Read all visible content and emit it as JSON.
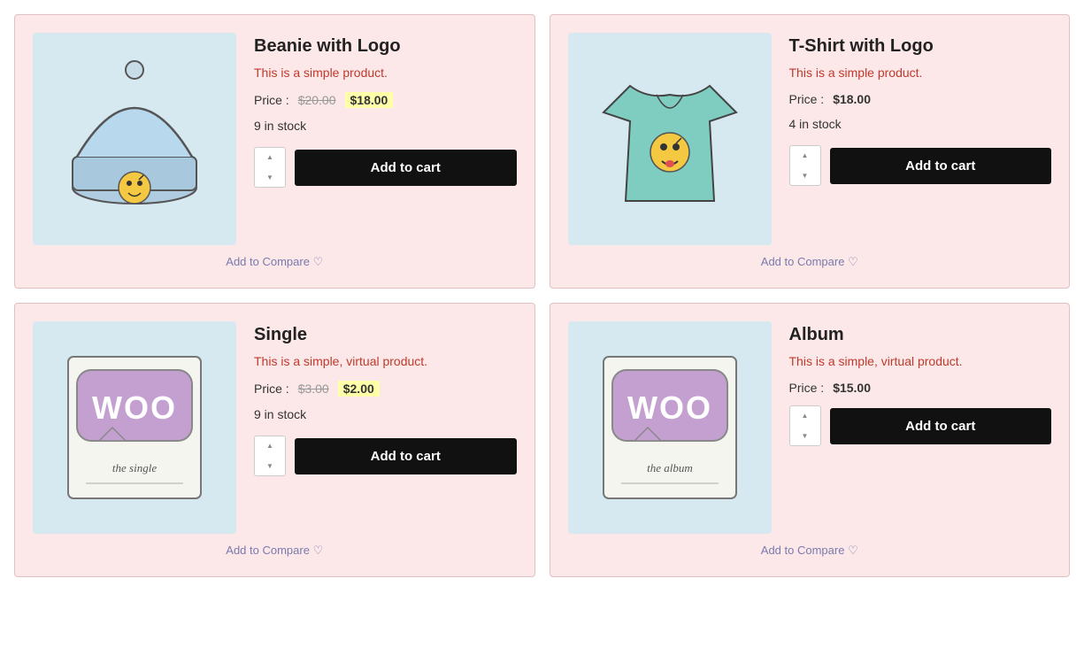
{
  "products": [
    {
      "id": "beanie-with-logo",
      "title": "Beanie with Logo",
      "description": "This is a simple product.",
      "price_label": "Price :",
      "price_old": "$20.00",
      "price_new": "$18.00",
      "price_new_highlighted": true,
      "price_current": null,
      "stock": "9 in stock",
      "add_to_cart_label": "Add to cart",
      "compare_label": "Add to Compare",
      "image_type": "beanie"
    },
    {
      "id": "tshirt-with-logo",
      "title": "T-Shirt with Logo",
      "description": "This is a simple product.",
      "price_label": "Price :",
      "price_old": null,
      "price_new": null,
      "price_new_highlighted": false,
      "price_current": "$18.00",
      "stock": "4 in stock",
      "add_to_cart_label": "Add to cart",
      "compare_label": "Add to Compare",
      "image_type": "tshirt"
    },
    {
      "id": "single",
      "title": "Single",
      "description": "This is a simple, virtual product.",
      "price_label": "Price :",
      "price_old": "$3.00",
      "price_new": "$2.00",
      "price_new_highlighted": true,
      "price_current": null,
      "stock": "9 in stock",
      "add_to_cart_label": "Add to cart",
      "compare_label": "Add to Compare",
      "image_type": "single"
    },
    {
      "id": "album",
      "title": "Album",
      "description": "This is a simple, virtual product.",
      "price_label": "Price :",
      "price_old": null,
      "price_new": null,
      "price_new_highlighted": false,
      "price_current": "$15.00",
      "stock": null,
      "add_to_cart_label": "Add to cart",
      "compare_label": "Add to Compare",
      "image_type": "album"
    }
  ]
}
